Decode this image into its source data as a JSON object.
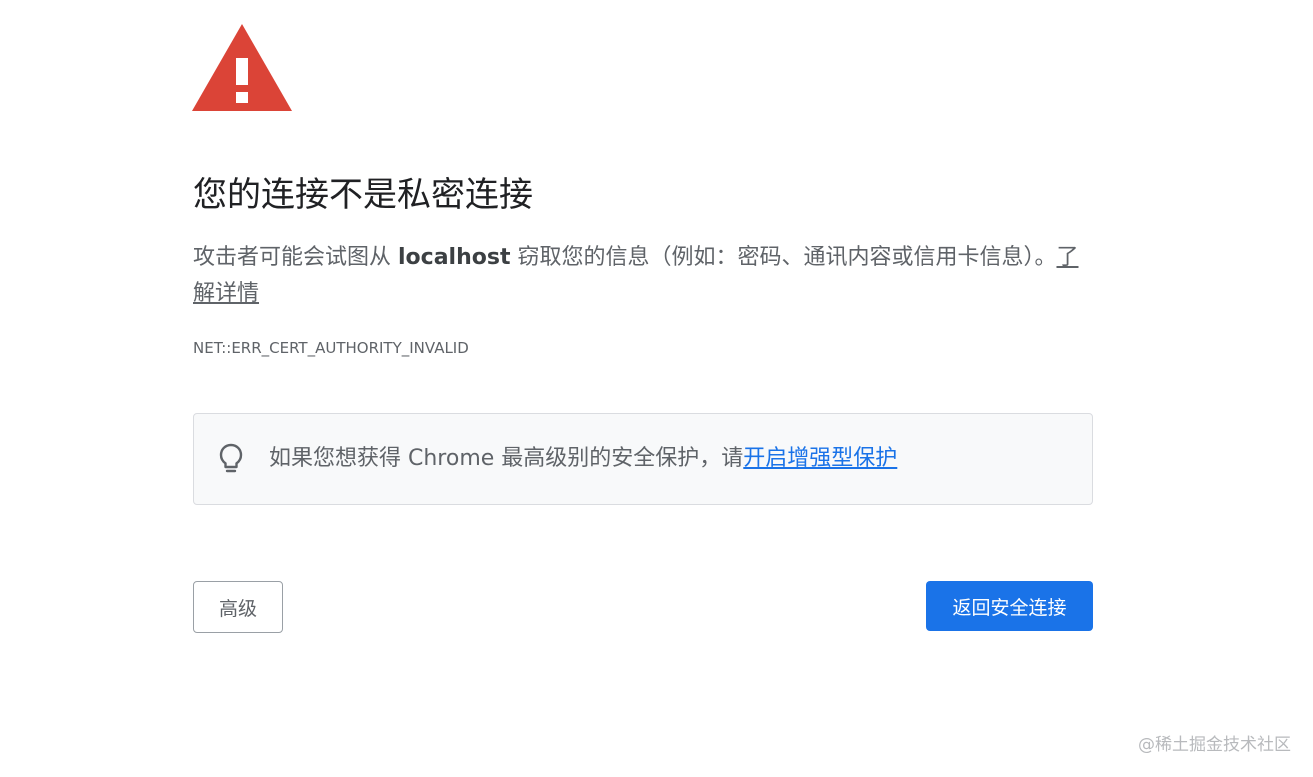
{
  "heading": "您的连接不是私密连接",
  "description": {
    "prefix": "攻击者可能会试图从 ",
    "host": "localhost",
    "suffix": " 窃取您的信息（例如：密码、通讯内容或信用卡信息）。",
    "learn_more_link": "了解详情"
  },
  "error_code": "NET::ERR_CERT_AUTHORITY_INVALID",
  "enhanced_protection_tip": {
    "text": "如果您想获得 Chrome 最高级别的安全保护，请",
    "link": "开启增强型保护"
  },
  "buttons": {
    "advanced": "高级",
    "back_to_safety": "返回安全连接"
  },
  "watermark": "@稀土掘金技术社区",
  "icons": {
    "warning": "warning-triangle-icon",
    "tip": "lightbulb-icon"
  },
  "colors": {
    "warning_red": "#db4437",
    "primary_blue": "#1a73e8",
    "tip_background": "#f8f9fa"
  }
}
